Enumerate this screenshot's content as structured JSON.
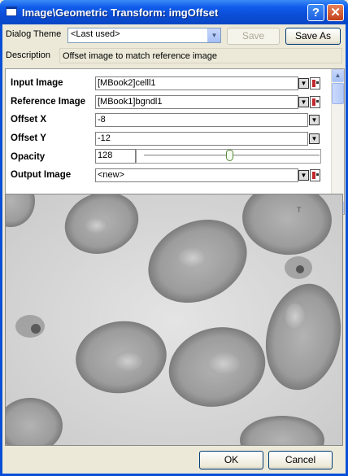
{
  "window": {
    "title": "Image\\Geometric Transform: imgOffset"
  },
  "title_buttons": {
    "help": "?",
    "close": "✕"
  },
  "theme": {
    "label": "Dialog Theme",
    "value": "<Last used>",
    "save_label": "Save",
    "save_as_label": "Save As"
  },
  "description": {
    "label": "Description",
    "text": "Offset image to match reference image"
  },
  "params": {
    "input_image": {
      "label": "Input Image",
      "value": "[MBook2]celll1"
    },
    "reference_image": {
      "label": "Reference Image",
      "value": "[MBook1]bgndl1"
    },
    "offset_x": {
      "label": "Offset X",
      "value": "-8"
    },
    "offset_y": {
      "label": "Offset Y",
      "value": "-12"
    },
    "opacity": {
      "label": "Opacity",
      "value": "128",
      "level": 0.5
    },
    "output_image": {
      "label": "Output Image",
      "value": "<new>"
    }
  },
  "preview": {
    "corner_mark": "T"
  },
  "footer": {
    "ok_label": "OK",
    "cancel_label": "Cancel"
  }
}
